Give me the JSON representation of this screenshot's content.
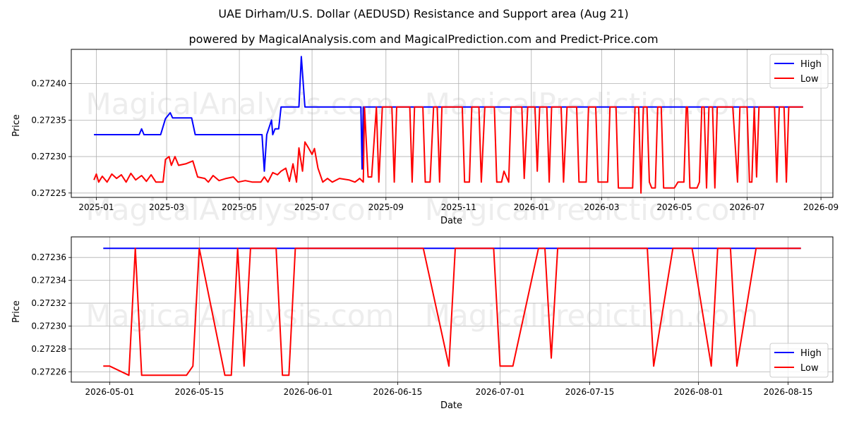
{
  "title": "UAE Dirham/U.S. Dollar (AEDUSD) Resistance and Support area (Aug 21)",
  "subtitle": "powered by MagicalAnalysis.com and MagicalPrediction.com and Predict-Price.com",
  "watermark_left": "MagicalAnalysis.com",
  "watermark_right": "MagicalPrediction.com",
  "colors": {
    "high": "#0000ff",
    "low": "#ff0000",
    "grid": "#b0b0b0"
  },
  "chart_data": [
    {
      "type": "line",
      "xlabel": "Date",
      "ylabel": "Price",
      "grid": true,
      "legend": "top-right",
      "xlim": [
        "2024-12-11",
        "2026-09-11"
      ],
      "ylim": [
        0.272244,
        0.272447
      ],
      "x_ticks": [
        "2025-01",
        "2025-03",
        "2025-05",
        "2025-07",
        "2025-09",
        "2025-11",
        "2026-01",
        "2026-03",
        "2026-05",
        "2026-07",
        "2026-09"
      ],
      "y_ticks": [
        "0.27225",
        "0.27230",
        "0.27235",
        "0.27240"
      ],
      "series": [
        {
          "name": "High",
          "color": "#0000ff",
          "points": [
            [
              "2024-12-30",
              0.27233
            ],
            [
              "2025-02-06",
              0.27233
            ],
            [
              "2025-02-08",
              0.272338
            ],
            [
              "2025-02-10",
              0.27233
            ],
            [
              "2025-02-24",
              0.27233
            ],
            [
              "2025-02-28",
              0.272352
            ],
            [
              "2025-03-04",
              0.27236
            ],
            [
              "2025-03-06",
              0.272353
            ],
            [
              "2025-03-22",
              0.272353
            ],
            [
              "2025-03-25",
              0.27233
            ],
            [
              "2025-05-20",
              0.27233
            ],
            [
              "2025-05-22",
              0.27228
            ],
            [
              "2025-05-24",
              0.27233
            ],
            [
              "2025-05-28",
              0.27235
            ],
            [
              "2025-05-29",
              0.27233
            ],
            [
              "2025-05-31",
              0.272338
            ],
            [
              "2025-06-03",
              0.272338
            ],
            [
              "2025-06-05",
              0.272368
            ],
            [
              "2025-06-20",
              0.272368
            ],
            [
              "2025-06-22",
              0.272437
            ],
            [
              "2025-06-25",
              0.272368
            ],
            [
              "2025-08-11",
              0.272368
            ],
            [
              "2025-08-12",
              0.272283
            ],
            [
              "2025-08-13",
              0.272368
            ],
            [
              "2026-08-17",
              0.272368
            ]
          ]
        },
        {
          "name": "Low",
          "color": "#ff0000",
          "points": [
            [
              "2024-12-30",
              0.272268
            ],
            [
              "2025-01-01",
              0.272276
            ],
            [
              "2025-01-03",
              0.272265
            ],
            [
              "2025-01-06",
              0.272273
            ],
            [
              "2025-01-10",
              0.272265
            ],
            [
              "2025-01-14",
              0.272276
            ],
            [
              "2025-01-18",
              0.27227
            ],
            [
              "2025-01-22",
              0.272275
            ],
            [
              "2025-01-26",
              0.272265
            ],
            [
              "2025-01-30",
              0.272277
            ],
            [
              "2025-02-03",
              0.272268
            ],
            [
              "2025-02-08",
              0.272274
            ],
            [
              "2025-02-12",
              0.272266
            ],
            [
              "2025-02-16",
              0.272275
            ],
            [
              "2025-02-20",
              0.272265
            ],
            [
              "2025-02-26",
              0.272265
            ],
            [
              "2025-02-28",
              0.272296
            ],
            [
              "2025-03-03",
              0.2723
            ],
            [
              "2025-03-05",
              0.272288
            ],
            [
              "2025-03-08",
              0.2723
            ],
            [
              "2025-03-11",
              0.272288
            ],
            [
              "2025-03-17",
              0.27229
            ],
            [
              "2025-03-23",
              0.272294
            ],
            [
              "2025-03-27",
              0.272272
            ],
            [
              "2025-04-02",
              0.27227
            ],
            [
              "2025-04-05",
              0.272265
            ],
            [
              "2025-04-09",
              0.272274
            ],
            [
              "2025-04-14",
              0.272267
            ],
            [
              "2025-04-20",
              0.27227
            ],
            [
              "2025-04-26",
              0.272272
            ],
            [
              "2025-04-30",
              0.272265
            ],
            [
              "2025-05-06",
              0.272267
            ],
            [
              "2025-05-12",
              0.272265
            ],
            [
              "2025-05-19",
              0.272265
            ],
            [
              "2025-05-22",
              0.272272
            ],
            [
              "2025-05-25",
              0.272265
            ],
            [
              "2025-05-29",
              0.272278
            ],
            [
              "2025-06-02",
              0.272275
            ],
            [
              "2025-06-05",
              0.27228
            ],
            [
              "2025-06-09",
              0.272284
            ],
            [
              "2025-06-12",
              0.272266
            ],
            [
              "2025-06-15",
              0.27229
            ],
            [
              "2025-06-18",
              0.272265
            ],
            [
              "2025-06-20",
              0.272312
            ],
            [
              "2025-06-23",
              0.27228
            ],
            [
              "2025-06-25",
              0.27232
            ],
            [
              "2025-06-28",
              0.272312
            ],
            [
              "2025-07-01",
              0.272303
            ],
            [
              "2025-07-03",
              0.272311
            ],
            [
              "2025-07-06",
              0.272284
            ],
            [
              "2025-07-10",
              0.272265
            ],
            [
              "2025-07-14",
              0.27227
            ],
            [
              "2025-07-18",
              0.272265
            ],
            [
              "2025-07-24",
              0.27227
            ],
            [
              "2025-08-01",
              0.272268
            ],
            [
              "2025-08-06",
              0.272265
            ],
            [
              "2025-08-10",
              0.27227
            ],
            [
              "2025-08-13",
              0.272265
            ],
            [
              "2025-08-14",
              0.272368
            ],
            [
              "2025-08-17",
              0.272272
            ],
            [
              "2025-08-20",
              0.272272
            ],
            [
              "2025-08-24",
              0.272368
            ],
            [
              "2025-08-26",
              0.272265
            ],
            [
              "2025-08-29",
              0.272368
            ],
            [
              "2025-09-06",
              0.272368
            ],
            [
              "2025-09-08",
              0.272265
            ],
            [
              "2025-09-10",
              0.272368
            ],
            [
              "2025-09-21",
              0.272368
            ],
            [
              "2025-09-23",
              0.272265
            ],
            [
              "2025-09-25",
              0.272368
            ],
            [
              "2025-10-02",
              0.272368
            ],
            [
              "2025-10-04",
              0.272265
            ],
            [
              "2025-10-08",
              0.272265
            ],
            [
              "2025-10-11",
              0.272368
            ],
            [
              "2025-10-14",
              0.272368
            ],
            [
              "2025-10-16",
              0.272265
            ],
            [
              "2025-10-18",
              0.272368
            ],
            [
              "2025-11-04",
              0.272368
            ],
            [
              "2025-11-06",
              0.272265
            ],
            [
              "2025-11-10",
              0.272265
            ],
            [
              "2025-11-12",
              0.272368
            ],
            [
              "2025-11-18",
              0.272368
            ],
            [
              "2025-11-20",
              0.272265
            ],
            [
              "2025-11-23",
              0.272368
            ],
            [
              "2025-12-01",
              0.272368
            ],
            [
              "2025-12-03",
              0.272265
            ],
            [
              "2025-12-07",
              0.272265
            ],
            [
              "2025-12-09",
              0.27228
            ],
            [
              "2025-12-13",
              0.272265
            ],
            [
              "2025-12-15",
              0.272368
            ],
            [
              "2025-12-24",
              0.272368
            ],
            [
              "2025-12-26",
              0.27227
            ],
            [
              "2025-12-29",
              0.272368
            ],
            [
              "2026-01-04",
              0.272368
            ],
            [
              "2026-01-06",
              0.27228
            ],
            [
              "2026-01-08",
              0.272368
            ],
            [
              "2026-01-14",
              0.272368
            ],
            [
              "2026-01-16",
              0.272265
            ],
            [
              "2026-01-18",
              0.272368
            ],
            [
              "2026-01-26",
              0.272368
            ],
            [
              "2026-01-28",
              0.272265
            ],
            [
              "2026-01-31",
              0.272368
            ],
            [
              "2026-02-08",
              0.272368
            ],
            [
              "2026-02-10",
              0.272265
            ],
            [
              "2026-02-16",
              0.272265
            ],
            [
              "2026-02-18",
              0.272368
            ],
            [
              "2026-02-24",
              0.272368
            ],
            [
              "2026-02-26",
              0.272265
            ],
            [
              "2026-03-06",
              0.272265
            ],
            [
              "2026-03-08",
              0.272368
            ],
            [
              "2026-03-13",
              0.272368
            ],
            [
              "2026-03-15",
              0.272257
            ],
            [
              "2026-03-27",
              0.272257
            ],
            [
              "2026-03-29",
              0.272368
            ],
            [
              "2026-04-01",
              0.272368
            ],
            [
              "2026-04-03",
              0.27225
            ],
            [
              "2026-04-05",
              0.272368
            ],
            [
              "2026-04-08",
              0.272368
            ],
            [
              "2026-04-10",
              0.272265
            ],
            [
              "2026-04-12",
              0.272257
            ],
            [
              "2026-04-15",
              0.272257
            ],
            [
              "2026-04-17",
              0.272368
            ],
            [
              "2026-04-20",
              0.272368
            ],
            [
              "2026-04-22",
              0.272257
            ],
            [
              "2026-05-01",
              0.272257
            ],
            [
              "2026-05-04",
              0.272265
            ],
            [
              "2026-05-09",
              0.272265
            ],
            [
              "2026-05-11",
              0.272368
            ],
            [
              "2026-05-12",
              0.272368
            ],
            [
              "2026-05-14",
              0.272257
            ],
            [
              "2026-05-20",
              0.272257
            ],
            [
              "2026-05-22",
              0.272265
            ],
            [
              "2026-05-24",
              0.272368
            ],
            [
              "2026-05-26",
              0.272368
            ],
            [
              "2026-05-28",
              0.272257
            ],
            [
              "2026-05-30",
              0.272368
            ],
            [
              "2026-06-02",
              0.272368
            ],
            [
              "2026-06-04",
              0.272257
            ],
            [
              "2026-06-06",
              0.272368
            ],
            [
              "2026-06-19",
              0.272368
            ],
            [
              "2026-06-23",
              0.272265
            ],
            [
              "2026-06-25",
              0.272368
            ],
            [
              "2026-07-01",
              0.272368
            ],
            [
              "2026-07-03",
              0.272265
            ],
            [
              "2026-07-05",
              0.272265
            ],
            [
              "2026-07-07",
              0.272368
            ],
            [
              "2026-07-09",
              0.272272
            ],
            [
              "2026-07-11",
              0.272368
            ],
            [
              "2026-07-24",
              0.272368
            ],
            [
              "2026-07-26",
              0.272265
            ],
            [
              "2026-07-28",
              0.272368
            ],
            [
              "2026-08-01",
              0.272368
            ],
            [
              "2026-08-03",
              0.272265
            ],
            [
              "2026-08-05",
              0.272368
            ],
            [
              "2026-08-17",
              0.272368
            ]
          ]
        }
      ]
    },
    {
      "type": "line",
      "xlabel": "Date",
      "ylabel": "Price",
      "grid": true,
      "legend": "bottom-right",
      "xlim": [
        "2026-04-25",
        "2026-08-22"
      ],
      "ylim": [
        0.272251,
        0.272378
      ],
      "x_ticks": [
        "2026-05-01",
        "2026-05-15",
        "2026-06-01",
        "2026-06-15",
        "2026-07-01",
        "2026-07-15",
        "2026-08-01",
        "2026-08-15"
      ],
      "y_ticks": [
        "0.27226",
        "0.27228",
        "0.27230",
        "0.27232",
        "0.27234",
        "0.27236"
      ],
      "series": [
        {
          "name": "High",
          "color": "#0000ff",
          "points": [
            [
              "2026-04-30",
              0.272368
            ],
            [
              "2026-08-17",
              0.272368
            ]
          ]
        },
        {
          "name": "Low",
          "color": "#ff0000",
          "points": [
            [
              "2026-04-30",
              0.272265
            ],
            [
              "2026-05-01",
              0.272265
            ],
            [
              "2026-05-04",
              0.272257
            ],
            [
              "2026-05-05",
              0.272368
            ],
            [
              "2026-05-06",
              0.272257
            ],
            [
              "2026-05-13",
              0.272257
            ],
            [
              "2026-05-14",
              0.272265
            ],
            [
              "2026-05-15",
              0.272368
            ],
            [
              "2026-05-19",
              0.272257
            ],
            [
              "2026-05-20",
              0.272257
            ],
            [
              "2026-05-21",
              0.272368
            ],
            [
              "2026-05-22",
              0.272265
            ],
            [
              "2026-05-23",
              0.272368
            ],
            [
              "2026-05-27",
              0.272368
            ],
            [
              "2026-05-28",
              0.272257
            ],
            [
              "2026-05-29",
              0.272257
            ],
            [
              "2026-05-30",
              0.272368
            ],
            [
              "2026-06-19",
              0.272368
            ],
            [
              "2026-06-23",
              0.272265
            ],
            [
              "2026-06-24",
              0.272368
            ],
            [
              "2026-06-30",
              0.272368
            ],
            [
              "2026-07-01",
              0.272265
            ],
            [
              "2026-07-03",
              0.272265
            ],
            [
              "2026-07-07",
              0.272368
            ],
            [
              "2026-07-08",
              0.272368
            ],
            [
              "2026-07-09",
              0.272272
            ],
            [
              "2026-07-10",
              0.272368
            ],
            [
              "2026-07-24",
              0.272368
            ],
            [
              "2026-07-25",
              0.272265
            ],
            [
              "2026-07-28",
              0.272368
            ],
            [
              "2026-07-31",
              0.272368
            ],
            [
              "2026-08-03",
              0.272265
            ],
            [
              "2026-08-04",
              0.272368
            ],
            [
              "2026-08-06",
              0.272368
            ],
            [
              "2026-08-07",
              0.272265
            ],
            [
              "2026-08-10",
              0.272368
            ],
            [
              "2026-08-17",
              0.272368
            ]
          ]
        }
      ]
    }
  ]
}
